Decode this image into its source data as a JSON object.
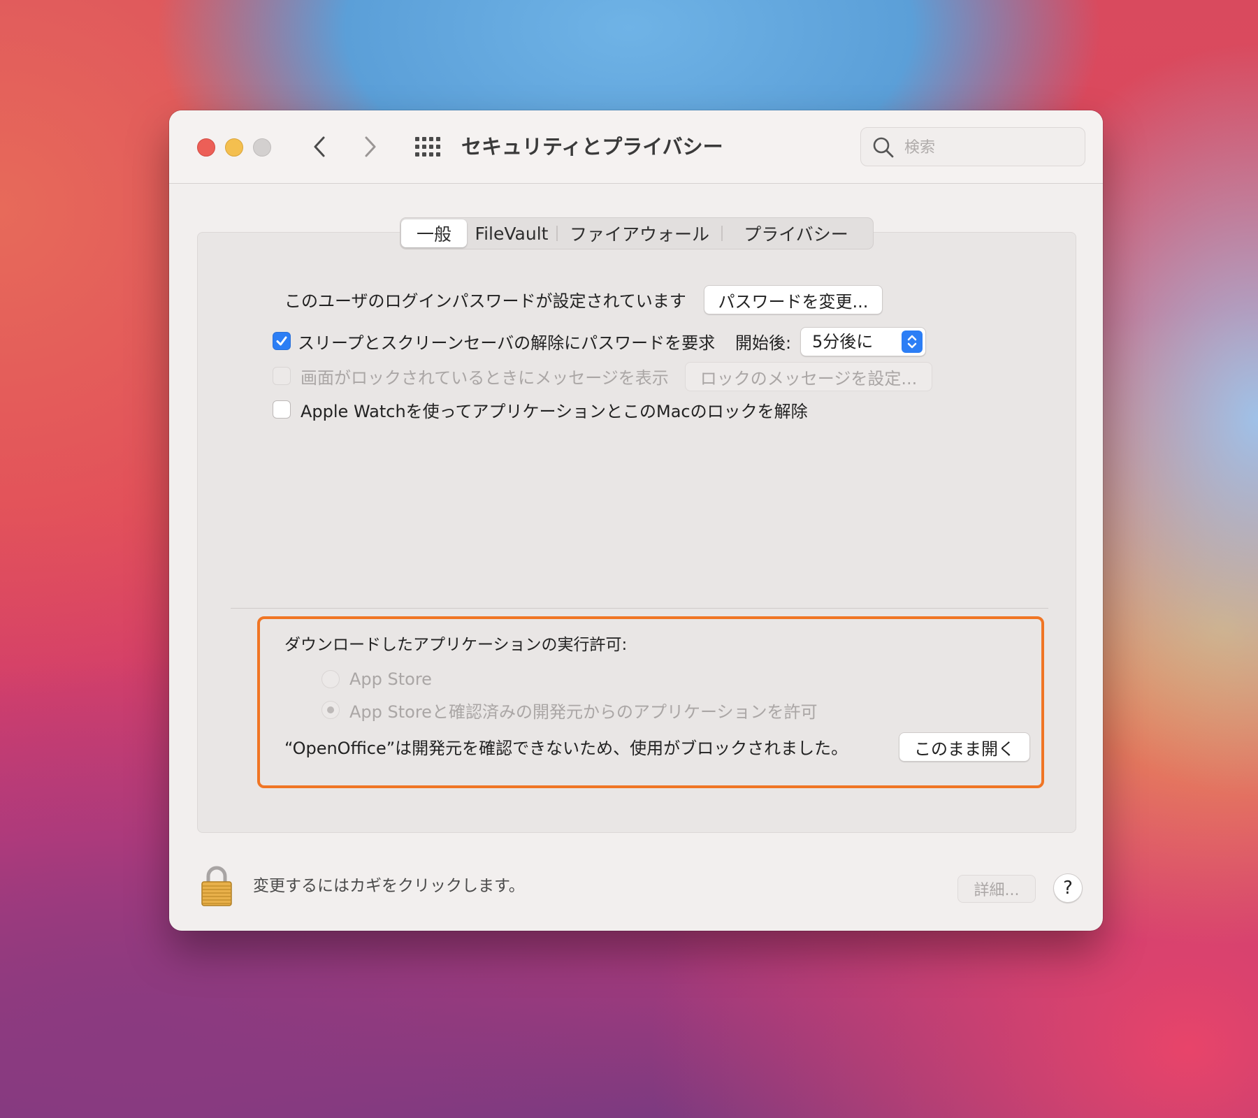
{
  "window": {
    "title": "セキュリティとプライバシー",
    "search_placeholder": "検索"
  },
  "tabs": [
    {
      "label": "一般",
      "active": true
    },
    {
      "label": "FileVault",
      "active": false
    },
    {
      "label": "ファイアウォール",
      "active": false
    },
    {
      "label": "プライバシー",
      "active": false
    }
  ],
  "general": {
    "password_text": "このユーザのログインパスワードが設定されています",
    "change_password_button": "パスワードを変更...",
    "require_password_label": "スリープとスクリーンセーバの解除にパスワードを要求",
    "require_password_checked": true,
    "after_label": "開始後:",
    "after_value": "5分後に",
    "show_message_label": "画面がロックされているときにメッセージを表示",
    "show_message_checked": false,
    "lock_message_button": "ロックのメッセージを設定...",
    "apple_watch_label": "Apple Watchを使ってアプリケーションとこのMacのロックを解除",
    "apple_watch_checked": false
  },
  "downloads": {
    "heading": "ダウンロードしたアプリケーションの実行許可:",
    "options": [
      {
        "label": "App Store",
        "selected": false
      },
      {
        "label": "App Storeと確認済みの開発元からのアプリケーションを許可",
        "selected": true
      }
    ],
    "blocked_message": "“OpenOffice”は開発元を確認できないため、使用がブロックされました。",
    "open_anyway_button": "このまま開く"
  },
  "footer": {
    "lock_text": "変更するにはカギをクリックします。",
    "advanced_button": "詳細...",
    "help_label": "?"
  },
  "colors": {
    "highlight": "#f07524",
    "accent": "#2c7ef5"
  }
}
